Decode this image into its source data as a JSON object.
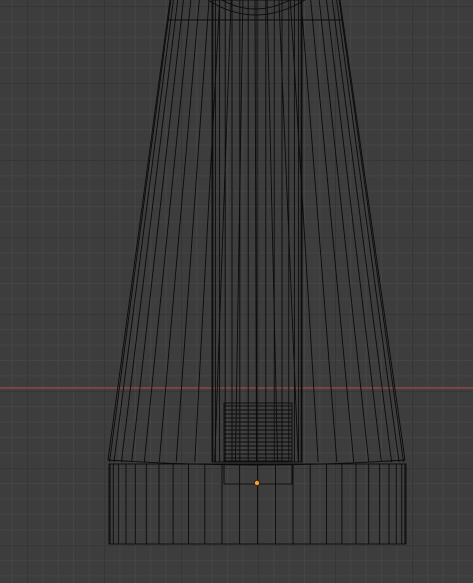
{
  "viewport": {
    "name": "3D Viewport",
    "view_mode": "wireframe",
    "background_color": "#3d3d3d",
    "grid_minor_color": "#454545",
    "grid_major_color": "#363636",
    "x_axis_color": "#9c4848",
    "wire_color": "#0b0b0b",
    "origin_color": "#f3a033"
  },
  "object": {
    "shape": "tapered-cylinder-lamp-base",
    "origin_icon": "origin-dot"
  }
}
